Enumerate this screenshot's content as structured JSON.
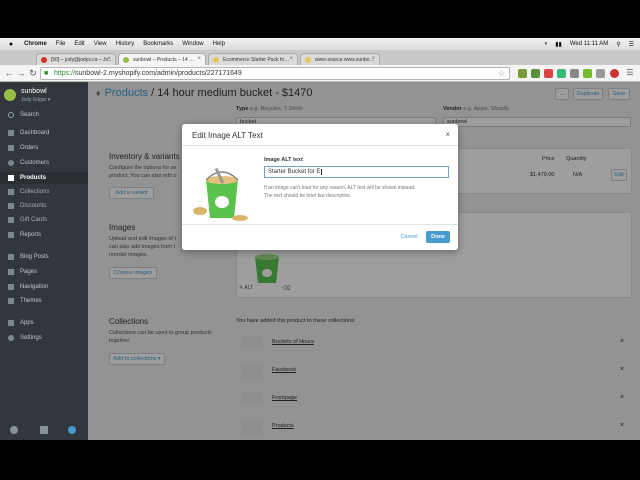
{
  "menubar": {
    "items": [
      "Chrome",
      "File",
      "Edit",
      "View",
      "History",
      "Bookmarks",
      "Window",
      "Help"
    ],
    "clock": "Wed 11:11 AM"
  },
  "tabs": [
    {
      "label": "[50] – jody@jodys.ca – Jo…",
      "color": "#d93025"
    },
    {
      "label": "sunbowl – Products – 14 …",
      "color": "#95bf47"
    },
    {
      "label": "Ecommerce Starter Pack fo…",
      "color": "#e8c75a"
    },
    {
      "label": "www-source.www.sunbo…",
      "color": "#e8c75a"
    }
  ],
  "address": {
    "scheme": "https://",
    "rest": "sunbowl-2.myshopify.com/admin/products/227171649"
  },
  "sidebar": {
    "store_name": "sunbowl",
    "user_name": "Jody Edgar ▾",
    "items": [
      {
        "label": "Search"
      },
      {
        "label": "Dashboard"
      },
      {
        "label": "Orders"
      },
      {
        "label": "Customers"
      },
      {
        "label": "Products"
      },
      {
        "label": "Collections"
      },
      {
        "label": "Discounts"
      },
      {
        "label": "Gift Cards"
      },
      {
        "label": "Reports"
      },
      {
        "label": "Blog Posts"
      },
      {
        "label": "Pages"
      },
      {
        "label": "Navigation"
      },
      {
        "label": "Themes"
      },
      {
        "label": "Apps"
      },
      {
        "label": "Settings"
      }
    ]
  },
  "header": {
    "breadcrumb": "Products",
    "separator": " / ",
    "product_title": "14 hour medium bucket - $1470",
    "more_label": "...",
    "duplicate_label": "Duplicate",
    "save_label": "Save"
  },
  "type_field": {
    "label": "Type",
    "hint": "e.g. Bicycles, T-Shirts",
    "value": "bucket"
  },
  "vendor_field": {
    "label": "Vendor",
    "hint": "e.g. Apple, Shopify",
    "value": "sunbowl"
  },
  "inventory": {
    "title": "Inventory & variants",
    "desc_1": "Configure the options for se",
    "desc_2": "product. You can also edit o",
    "add_variant": "Add a variant",
    "price_header": "Price",
    "quantity_header": "Quantity",
    "price": "$1,470.00",
    "quantity": "N/A",
    "edit_label": "Edit"
  },
  "images": {
    "title": "Images",
    "desc_1": "Upload and edit images of t",
    "desc_2": "can also add images from t",
    "desc_3": "reorder images.",
    "choose_label": "Choose images",
    "alt_label": "ALT"
  },
  "collections": {
    "title": "Collections",
    "desc_1": "Collections can be used to group products",
    "desc_2": "together.",
    "add_label": "Add to collections ▾",
    "added_text": "You have added this product to these collections:",
    "items": [
      "Buckets of Hours",
      "Facebook",
      "Frontpage",
      "Products"
    ]
  },
  "modal": {
    "title": "Edit Image ALT Text",
    "close": "×",
    "field_label": "Image ALT text",
    "field_value": "Starter Bucket for E",
    "help_1": "If an image can't load for any reason, ALT text will be shown instead.",
    "help_2": "The text should be brief but descriptive.",
    "cancel_label": "Cancel",
    "done_label": "Done"
  },
  "colors": {
    "accent": "#479ccf",
    "sidebar": "#31373d",
    "brand": "#95bf47"
  }
}
